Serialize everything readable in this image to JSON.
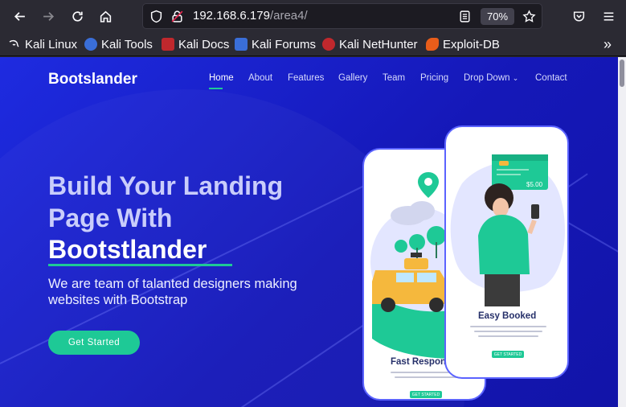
{
  "browser": {
    "url_host": "192.168.6.179",
    "url_path": "/area4/",
    "zoom": "70%",
    "bookmarks": [
      {
        "label": "Kali Linux",
        "color": "#2b2a33"
      },
      {
        "label": "Kali Tools",
        "color": "#3a6ed8"
      },
      {
        "label": "Kali Docs",
        "color": "#c0282d"
      },
      {
        "label": "Kali Forums",
        "color": "#3a6ed8"
      },
      {
        "label": "Kali NetHunter",
        "color": "#c0282d"
      },
      {
        "label": "Exploit-DB",
        "color": "#e85d1a"
      }
    ]
  },
  "site": {
    "brand": "Bootslander",
    "nav": [
      "Home",
      "About",
      "Features",
      "Gallery",
      "Team",
      "Pricing",
      "Drop Down",
      "Contact"
    ],
    "hero": {
      "line1": "Build Your Landing",
      "line2": "Page With",
      "line3": "Bootstlander",
      "sub1": "We are team of talanted designers making",
      "sub2": "websites with Bootstrap",
      "cta": "Get Started"
    },
    "phone_left": {
      "title": "Fast Respon",
      "button": "GET STARTED"
    },
    "phone_right": {
      "title": "Easy Booked",
      "price": "$5.00",
      "button": "GET STARTED"
    }
  },
  "colors": {
    "accent": "#1ec996",
    "hero_bg": "#1518b8"
  }
}
